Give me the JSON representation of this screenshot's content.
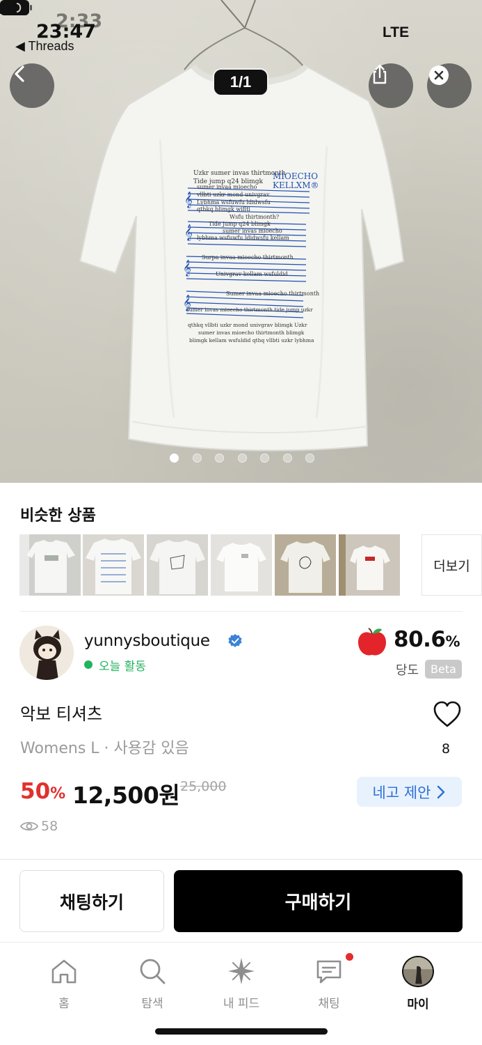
{
  "status_bar": {
    "time": "23:47",
    "time_ghost": "2:33",
    "back_app": "◀ Threads",
    "network": "LTE"
  },
  "viewer": {
    "counter": "1/1",
    "dot_count": 7,
    "active_dot": 0
  },
  "shirt_print": {
    "header_lines": [
      "Uzkr sumer invas thirtmonth",
      "Tide jump q24 blimgk"
    ],
    "brand_lines": [
      "MIOECHO",
      "KELLXM®"
    ],
    "staff_lines": [
      "sumer invaa mioecho",
      "vllbti uzkr mond univgrav",
      "Lybhma wsfuwfu ldidwsfu",
      "qthkq blimgk wiflti",
      "Wsfu thirtmonth?",
      "Tide jump q24 blimgk",
      "sumer invas mioecho",
      "lybhma wsfuwfu ldidwsfu kellam",
      "Surpa invaa mioecho thirtmonth",
      "Univgrav kellam wsfuldid",
      "Sumer invaa mioecho thirtmonth",
      "sumer invas mioecho thirtmonth tide jump uzkr",
      "qthkq vllbti uzkr mond univgrav blimgk Uzkr",
      "sumer invas mioecho thirtmonth blimgk",
      "blimgk kellam wsfuldid qthq vllbti uzkr lybhma"
    ]
  },
  "similar": {
    "title": "비슷한 상품",
    "more_label": "더보기"
  },
  "seller": {
    "name": "yunnysboutique",
    "activity": "오늘 활동",
    "score": "80.6",
    "score_unit": "%",
    "score_label": "당도",
    "beta": "Beta"
  },
  "product": {
    "title": "악보 티셔츠",
    "subtitle": "Womens L · 사용감 있음",
    "likes": "8",
    "discount": "50",
    "discount_unit": "%",
    "price": "12,500원",
    "original_price": "25,000",
    "offer_label": "네고 제안",
    "views": "58"
  },
  "actions": {
    "chat_label": "채팅하기",
    "buy_label": "구매하기"
  },
  "tabs": [
    {
      "label": "홈",
      "icon": "home-icon"
    },
    {
      "label": "탐색",
      "icon": "search-icon"
    },
    {
      "label": "내 피드",
      "icon": "sparkle-icon"
    },
    {
      "label": "채팅",
      "icon": "chat-icon"
    },
    {
      "label": "마이",
      "icon": "profile-avatar"
    }
  ],
  "colors": {
    "discount": "#e0312d",
    "offer_text": "#2f6fd6",
    "offer_bg": "#e8f2fd",
    "active_green": "#22b35e",
    "print_blue": "#1f4fb0"
  }
}
